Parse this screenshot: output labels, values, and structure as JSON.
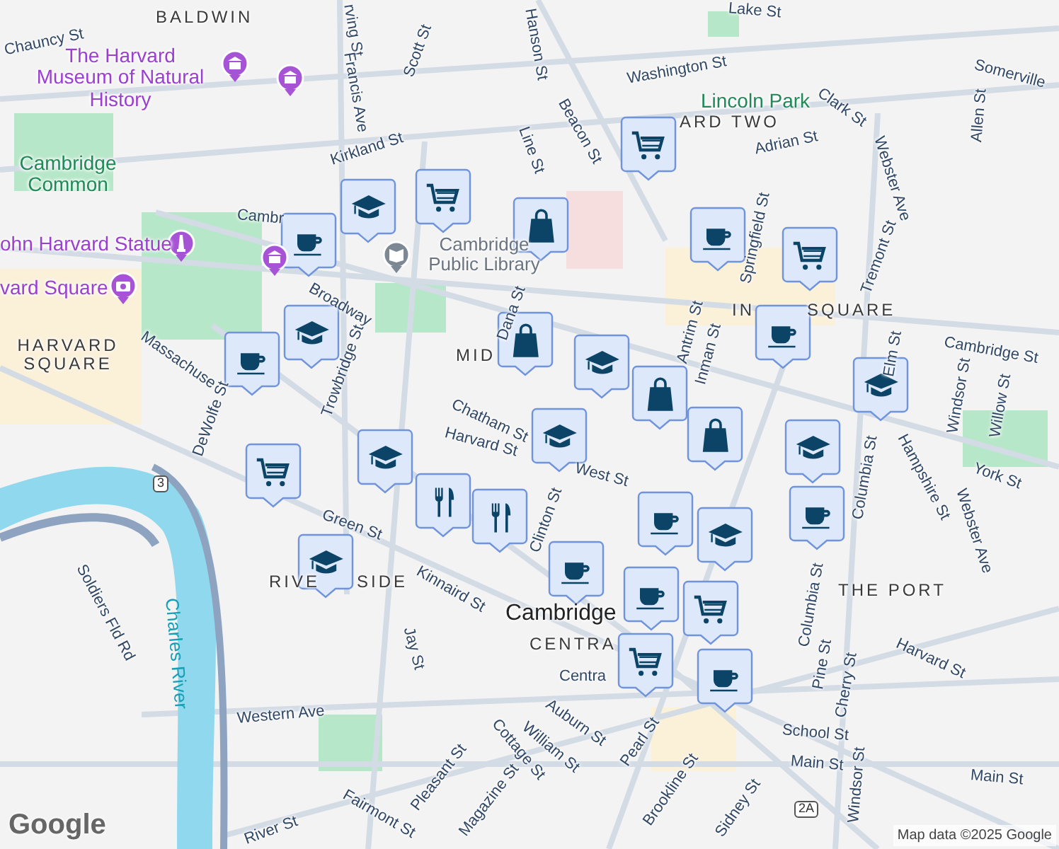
{
  "map": {
    "labels": [
      {
        "text": "Chauncy St",
        "kind": "street"
      },
      {
        "text": "BALDWIN",
        "kind": "area"
      },
      {
        "text": "The Harvard Museum of Natural History",
        "kind": "poi"
      },
      {
        "text": "rving St",
        "kind": "street"
      },
      {
        "text": "Francis Ave",
        "kind": "street"
      },
      {
        "text": "Scott St",
        "kind": "street"
      },
      {
        "text": "Kirkland St",
        "kind": "street"
      },
      {
        "text": "Cambridge Common",
        "kind": "park"
      },
      {
        "text": "Cambr",
        "kind": "street"
      },
      {
        "text": "ohn Harvard Statue",
        "kind": "poi"
      },
      {
        "text": "vard Square",
        "kind": "poi"
      },
      {
        "text": "HARVARD SQUARE",
        "kind": "area"
      },
      {
        "text": "Cambridge Public Library",
        "kind": "library"
      },
      {
        "text": "Broadway",
        "kind": "street"
      },
      {
        "text": "Massachuse",
        "kind": "street"
      },
      {
        "text": "Dana St",
        "kind": "street"
      },
      {
        "text": "Line St",
        "kind": "street"
      },
      {
        "text": "Beacon St",
        "kind": "street"
      },
      {
        "text": "Washington St",
        "kind": "street"
      },
      {
        "text": "Hanson St",
        "kind": "street"
      },
      {
        "text": "Lake St",
        "kind": "street"
      },
      {
        "text": "Lincoln Park",
        "kind": "park"
      },
      {
        "text": "Clark St",
        "kind": "street"
      },
      {
        "text": "ARD TWO",
        "kind": "area"
      },
      {
        "text": "Adrian St",
        "kind": "street"
      },
      {
        "text": "Allen St",
        "kind": "street"
      },
      {
        "text": "Somerville",
        "kind": "street"
      },
      {
        "text": "Webster Ave",
        "kind": "street"
      },
      {
        "text": "Tremont St",
        "kind": "street"
      },
      {
        "text": "Springfield St",
        "kind": "street"
      },
      {
        "text": "IN",
        "kind": "area"
      },
      {
        "text": "SQUARE",
        "kind": "area"
      },
      {
        "text": "Cambridge St",
        "kind": "street"
      },
      {
        "text": "MID",
        "kind": "area"
      },
      {
        "text": "Antrim St",
        "kind": "street"
      },
      {
        "text": "Inman St",
        "kind": "street"
      },
      {
        "text": "Elm St",
        "kind": "street"
      },
      {
        "text": "Windsor St",
        "kind": "street"
      },
      {
        "text": "Willow St",
        "kind": "street"
      },
      {
        "text": "York St",
        "kind": "street"
      },
      {
        "text": "Hampshire St",
        "kind": "street"
      },
      {
        "text": "Columbia St",
        "kind": "street"
      },
      {
        "text": "Webster Ave",
        "kind": "street"
      },
      {
        "text": "Chatham St",
        "kind": "street"
      },
      {
        "text": "Harvard St",
        "kind": "street"
      },
      {
        "text": "West St",
        "kind": "street"
      },
      {
        "text": "Trowbridge St",
        "kind": "street"
      },
      {
        "text": "DeWolfe St",
        "kind": "street"
      },
      {
        "text": "Green St",
        "kind": "street"
      },
      {
        "text": "RIVE",
        "kind": "area"
      },
      {
        "text": "SIDE",
        "kind": "area"
      },
      {
        "text": "Kinnaird St",
        "kind": "street"
      },
      {
        "text": "Jay St",
        "kind": "street"
      },
      {
        "text": "Clinton St",
        "kind": "street"
      },
      {
        "text": "Soldiers Fld Rd",
        "kind": "street"
      },
      {
        "text": "Charles River",
        "kind": "water"
      },
      {
        "text": "3",
        "kind": "shield"
      },
      {
        "text": "Cambridge",
        "kind": "city"
      },
      {
        "text": "CENTRA",
        "kind": "area"
      },
      {
        "text": "THE PORT",
        "kind": "area"
      },
      {
        "text": "Columbia St",
        "kind": "street"
      },
      {
        "text": "Harvard St",
        "kind": "street"
      },
      {
        "text": "Pine St",
        "kind": "street"
      },
      {
        "text": "Cherry St",
        "kind": "street"
      },
      {
        "text": "Western Ave",
        "kind": "street"
      },
      {
        "text": "Centra",
        "kind": "street"
      },
      {
        "text": "Auburn St",
        "kind": "street"
      },
      {
        "text": "William St",
        "kind": "street"
      },
      {
        "text": "Pearl St",
        "kind": "street"
      },
      {
        "text": "School St",
        "kind": "street"
      },
      {
        "text": "Main St",
        "kind": "street"
      },
      {
        "text": "Main St",
        "kind": "street"
      },
      {
        "text": "Windsor St",
        "kind": "street"
      },
      {
        "text": "Brookline St",
        "kind": "street"
      },
      {
        "text": "Sidney St",
        "kind": "street"
      },
      {
        "text": "Cottage St",
        "kind": "street"
      },
      {
        "text": "Pleasant St",
        "kind": "street"
      },
      {
        "text": "Magazine St",
        "kind": "street"
      },
      {
        "text": "Fairmont St",
        "kind": "street"
      },
      {
        "text": "River St",
        "kind": "street"
      },
      {
        "text": "2A",
        "kind": "shield"
      }
    ],
    "places": [
      {
        "kind": "museum"
      },
      {
        "kind": "museum"
      },
      {
        "kind": "monument"
      },
      {
        "kind": "camera"
      },
      {
        "kind": "museum"
      },
      {
        "kind": "library"
      }
    ],
    "markers": [
      {
        "kind": "grocery"
      },
      {
        "kind": "grocery"
      },
      {
        "kind": "school"
      },
      {
        "kind": "cafe"
      },
      {
        "kind": "shop"
      },
      {
        "kind": "cafe"
      },
      {
        "kind": "grocery"
      },
      {
        "kind": "school"
      },
      {
        "kind": "cafe"
      },
      {
        "kind": "shop"
      },
      {
        "kind": "cafe"
      },
      {
        "kind": "school"
      },
      {
        "kind": "shop"
      },
      {
        "kind": "shop"
      },
      {
        "kind": "school"
      },
      {
        "kind": "school"
      },
      {
        "kind": "school"
      },
      {
        "kind": "grocery"
      },
      {
        "kind": "school"
      },
      {
        "kind": "restaurant"
      },
      {
        "kind": "restaurant"
      },
      {
        "kind": "cafe"
      },
      {
        "kind": "school"
      },
      {
        "kind": "cafe"
      },
      {
        "kind": "school"
      },
      {
        "kind": "cafe"
      },
      {
        "kind": "grocery"
      },
      {
        "kind": "cafe"
      },
      {
        "kind": "grocery"
      },
      {
        "kind": "cafe"
      }
    ]
  },
  "logo": "Google",
  "attribution": "Map data ©2025 Google"
}
